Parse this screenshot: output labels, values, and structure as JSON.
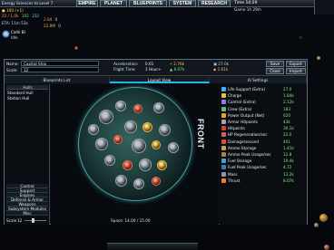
{
  "topbar": {
    "energy": "Energy Sciences to Level 7",
    "tabs": [
      "EMPIRE",
      "PLANET",
      "BLUEPRINTS",
      "SYSTEM",
      "RESEARCH"
    ],
    "time": "Time 14:29",
    "game_speed": "Game 1h 29m",
    "credits": "100 (+1)",
    "resources": [
      "22 / 1,0k",
      "102",
      "232"
    ],
    "resources2": [
      "2.04",
      "0",
      "22.8M",
      "0"
    ],
    "eta": "ETA: 11m 53s",
    "fleet_name": "Cahli Bl",
    "fleet_sub": "Idle"
  },
  "designer": {
    "name_label": "Name:",
    "name_value": "Capital Ship",
    "scale_label": "Scale:",
    "scale_value": "12",
    "acceleration_label": "Acceleration:",
    "acceleration_value": "0.61",
    "flight_time_label": "Flight Time:",
    "flight_time_value": "1 Hour+",
    "stat1": "2.76k",
    "stat2": "27.0k",
    "stat3": "6.07k",
    "stat4": "1.61k",
    "save": "Save",
    "export": "Export",
    "close": "Close",
    "import": "Import"
  },
  "tabs": {
    "blueprints_list": "Blueprints List",
    "layout_view": "Layout View",
    "ai_settings": "AI Settings"
  },
  "blueprints": {
    "header": "Hulls",
    "items": [
      "Standard Hull",
      "Station Hull"
    ],
    "categories": [
      "Control",
      "Support",
      "Engines",
      "Defense & Armor",
      "Weapons",
      "Subsystem Modules",
      "Misc"
    ],
    "scale_label": "Scale",
    "scale_value": "12"
  },
  "layout": {
    "front_label": "FRONT",
    "space_used": "Space: 14.00 / 15.00"
  },
  "stats": [
    {
      "name": "Life Support (Extra)",
      "value": "27.0",
      "color": "#3fb0ff"
    },
    {
      "name": "Charge",
      "value": "1.84k",
      "color": "#e0c040"
    },
    {
      "name": "Control (Extra)",
      "value": "2.12k",
      "color": "#8a7cf0"
    },
    {
      "name": "Crew (Extra)",
      "value": "183",
      "color": "#58c070"
    },
    {
      "name": "Power Output (Net)",
      "value": "620",
      "color": "#f0a030"
    },
    {
      "name": "Armor Hitpoints",
      "value": "43k",
      "color": "#a0a8b0"
    },
    {
      "name": "Hitpoints",
      "value": "30.1k",
      "color": "#d04040"
    },
    {
      "name": "HP Regeneration/sec",
      "value": "22.0",
      "color": "#d06060"
    },
    {
      "name": "Damage/second",
      "value": "401",
      "color": "#e05030"
    },
    {
      "name": "Ammo Storage",
      "value": "1.41k",
      "color": "#c0a060"
    },
    {
      "name": "Ammo Peak Usage/sec",
      "value": "12.8",
      "color": "#b08040"
    },
    {
      "name": "Fuel Storage",
      "value": "19.4k",
      "color": "#40a0d0"
    },
    {
      "name": "Fuel Peak Usage/sec",
      "value": "4.72",
      "color": "#3080b0"
    },
    {
      "name": "Mass",
      "value": "13.2k",
      "color": "#909aa4"
    },
    {
      "name": "Thrust",
      "value": "8.07k",
      "color": "#f08030"
    }
  ]
}
